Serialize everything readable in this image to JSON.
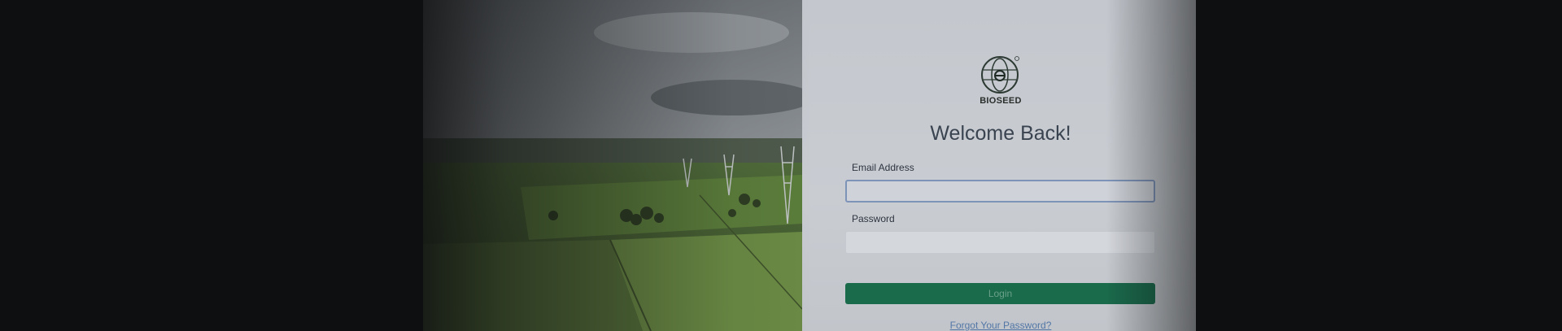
{
  "brand": {
    "name": "BIOSEED"
  },
  "login": {
    "title": "Welcome Back!",
    "email_label": "Email Address",
    "email_value": "",
    "password_label": "Password",
    "password_value": "",
    "submit_label": "Login",
    "forgot_label": "Forgot Your Password?"
  },
  "colors": {
    "accent": "#1f8a4f",
    "button": "#1a6a4c",
    "link": "#5376a6"
  },
  "icons": {
    "logo": "bioseed-logo-icon"
  }
}
